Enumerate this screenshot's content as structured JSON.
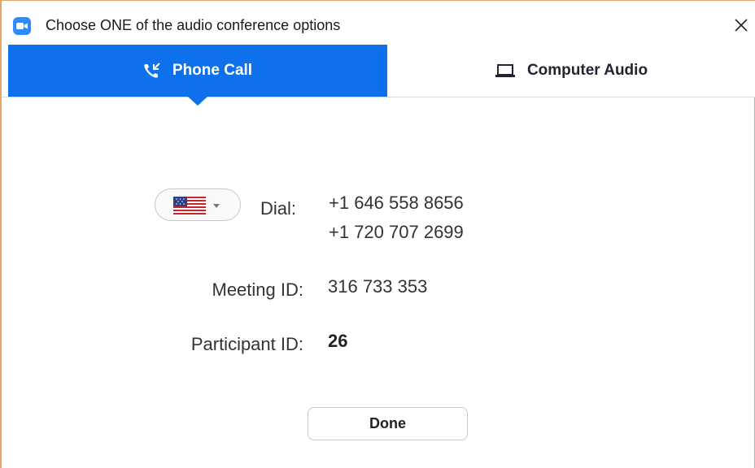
{
  "window": {
    "title": "Choose ONE of the audio conference options",
    "app_icon": "zoom-video-icon",
    "close_icon": "close-icon"
  },
  "tabs": [
    {
      "label": "Phone Call",
      "icon": "phone-call-icon",
      "selected": true
    },
    {
      "label": "Computer Audio",
      "icon": "laptop-icon",
      "selected": false
    }
  ],
  "phone": {
    "country_selector": {
      "icon": "us-flag-icon",
      "selected_country": "United States"
    },
    "dial_label": "Dial:",
    "dial_numbers": [
      "+1 646 558 8656",
      "+1 720 707 2699"
    ],
    "meeting_id_label": "Meeting ID:",
    "meeting_id": "316 733 353",
    "participant_id_label": "Participant ID:",
    "participant_id": "26"
  },
  "actions": {
    "done_label": "Done"
  },
  "colors": {
    "accent": "#0e71eb",
    "app_icon": "#2d8cff",
    "window_border": "#e8a46a"
  }
}
